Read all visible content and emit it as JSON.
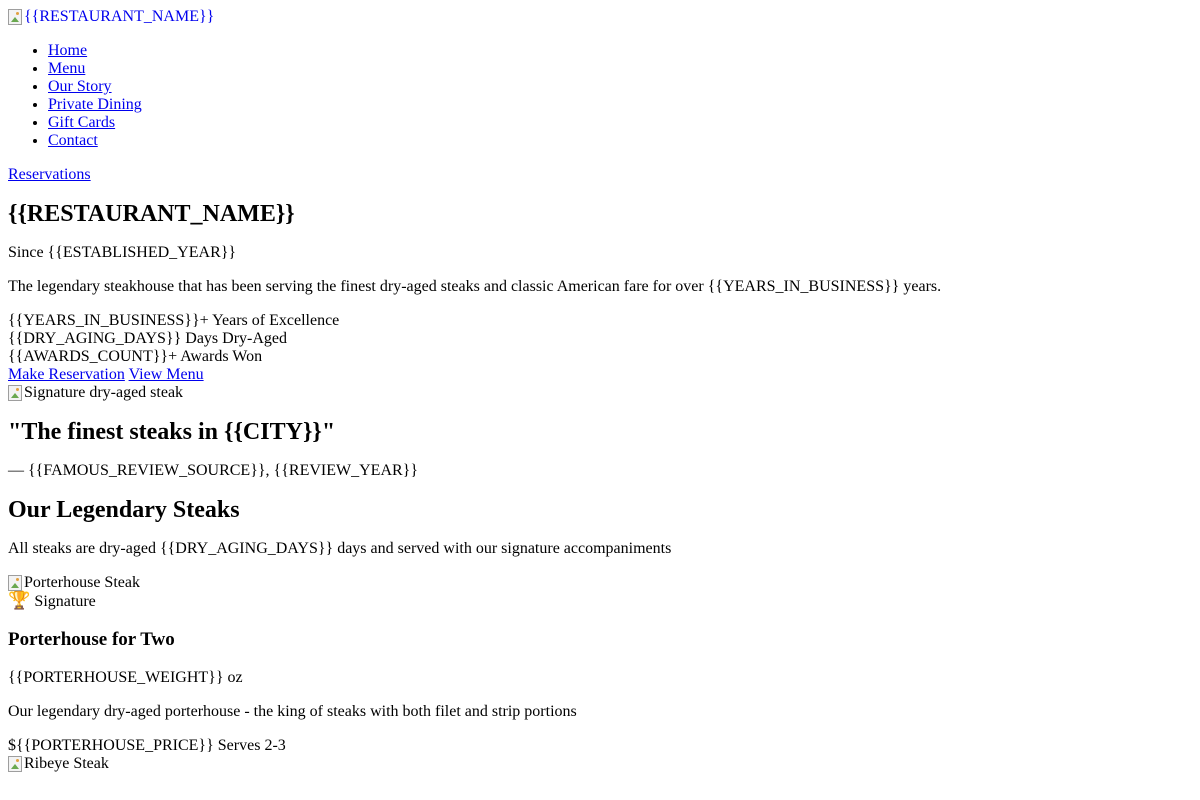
{
  "header": {
    "logo_alt": "{{RESTAURANT_NAME}}",
    "nav": [
      {
        "label": "Home"
      },
      {
        "label": "Menu"
      },
      {
        "label": "Our Story"
      },
      {
        "label": "Private Dining"
      },
      {
        "label": "Gift Cards"
      },
      {
        "label": "Contact"
      }
    ],
    "reservations_label": "Reservations"
  },
  "hero": {
    "title": "{{RESTAURANT_NAME}}",
    "since": "Since {{ESTABLISHED_YEAR}}",
    "tagline": "The legendary steakhouse that has been serving the finest dry-aged steaks and classic American fare for over {{YEARS_IN_BUSINESS}} years.",
    "stats": [
      {
        "value": "{{YEARS_IN_BUSINESS}}+",
        "label": " Years of Excellence"
      },
      {
        "value": "{{DRY_AGING_DAYS}}",
        "label": " Days Dry-Aged"
      },
      {
        "value": "{{AWARDS_COUNT}}+",
        "label": " Awards Won"
      }
    ],
    "primary_cta": "Make Reservation",
    "secondary_cta": "View Menu",
    "image_alt": "Signature dry-aged steak"
  },
  "review": {
    "quote": "\"The finest steaks in {{CITY}}\"",
    "source": "— {{FAMOUS_REVIEW_SOURCE}}, {{REVIEW_YEAR}}"
  },
  "steaks": {
    "title": "Our Legendary Steaks",
    "subtitle": "All steaks are dry-aged {{DRY_AGING_DAYS}} days and served with our signature accompaniments",
    "items": [
      {
        "image_alt": "Porterhouse Steak",
        "badge_icon": "🏆",
        "badge_label": " Signature",
        "name": "Porterhouse for Two",
        "weight": "{{PORTERHOUSE_WEIGHT}} oz",
        "description": "Our legendary dry-aged porterhouse - the king of steaks with both filet and strip portions",
        "price": "${{PORTERHOUSE_PRICE}}",
        "serves": " Serves 2-3"
      },
      {
        "image_alt": "Ribeye Steak"
      }
    ]
  }
}
